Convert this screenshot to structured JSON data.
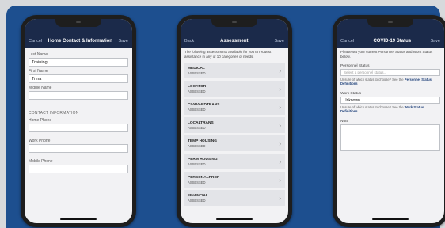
{
  "phone1": {
    "nav": {
      "left": "Cancel",
      "title": "Home Contact & Information",
      "right": "Save"
    },
    "fields": [
      {
        "label": "Last Name",
        "value": "Training"
      },
      {
        "label": "First Name",
        "value": "Trina"
      },
      {
        "label": "Middle Name",
        "value": ""
      }
    ],
    "section_title": "CONTACT INFORMATION",
    "contact_fields": [
      {
        "label": "Home Phone",
        "value": ""
      },
      {
        "label": "Work Phone",
        "value": ""
      },
      {
        "label": "Mobile Phone",
        "value": ""
      }
    ]
  },
  "phone2": {
    "nav": {
      "left": "Back",
      "title": "Assessment",
      "right": "Save"
    },
    "intro": "The following assessments available for you to request assistance in any of 10 categories of needs.",
    "items": [
      {
        "title": "MEDICAL",
        "status": "ASSESSED"
      },
      {
        "title": "LOCATOR",
        "status": "ASSESSED"
      },
      {
        "title": "CIVAVARDTRANS",
        "status": "ASSESSED"
      },
      {
        "title": "LOCALTRANS",
        "status": "ASSESSED"
      },
      {
        "title": "TEMP HOUSING",
        "status": "ASSESSED"
      },
      {
        "title": "PERM HOUSING",
        "status": "ASSESSED"
      },
      {
        "title": "PERSONALPROP",
        "status": "ASSESSED"
      },
      {
        "title": "FINANCIAL",
        "status": "ASSESSED"
      }
    ]
  },
  "phone3": {
    "nav": {
      "left": "Cancel",
      "title": "COVID-19 Status",
      "right": "Save"
    },
    "intro": "Please set your current Personnel Status and Work Status below.",
    "personnel": {
      "label": "Personnel Status",
      "placeholder": "Select a personnel status...",
      "help": "Unsure of which status to choose? See the",
      "link": "Personnel Status Definitions"
    },
    "work": {
      "label": "Work Status",
      "value": "Unknown",
      "help": "Unsure of which status to choose? See the",
      "link": "Work Status Definitions"
    },
    "note_label": "Note"
  },
  "colors": {
    "background": "#d7d9dc",
    "panel": "#1d4f8f",
    "navbar": "#1b2a4a",
    "screen": "#f2f2f4"
  },
  "icons": {
    "chevron": "chevron-right-icon"
  }
}
